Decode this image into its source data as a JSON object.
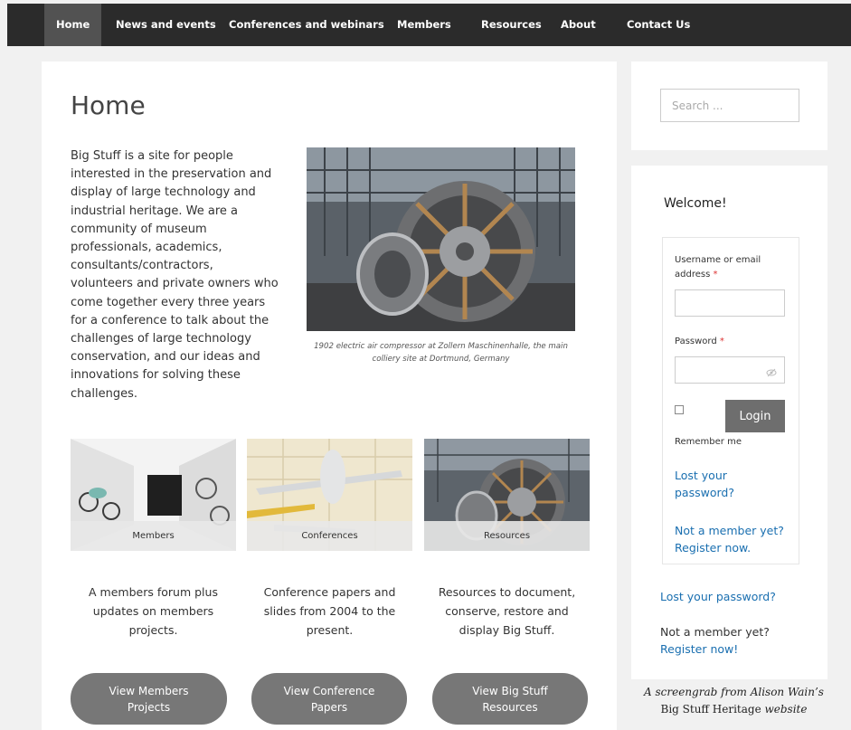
{
  "nav": {
    "items": [
      "Home",
      "News and events",
      "Conferences and webinars",
      "Members",
      "Resources",
      "About",
      "Contact Us"
    ],
    "active": "Home"
  },
  "main": {
    "title": "Home",
    "intro": "Big Stuff is a site for people interested in the preservation and display of large technology and industrial heritage. We are a community of museum professionals, academics, consultants/contractors, volunteers and private owners who come together every three years for a conference to talk about the challenges of large technology conservation, and our ideas and innovations for solving these challenges.",
    "hero_caption": "1902 electric air compressor at Zollern Maschinenhalle, the main colliery site at Dortmund, Germany",
    "tiles": [
      {
        "label": "Members",
        "description": "A members forum plus updates on members projects.",
        "button": "View Members Projects"
      },
      {
        "label": "Conferences",
        "description": "Conference papers and slides from 2004 to the present.",
        "button": "View Conference Papers"
      },
      {
        "label": "Resources",
        "description": "Resources to document, conserve, restore and display Big Stuff.",
        "button": "View Big Stuff Resources"
      }
    ]
  },
  "sidebar": {
    "search_placeholder": "Search ...",
    "welcome": "Welcome!",
    "login": {
      "username_label": "Username or email address",
      "password_label": "Password",
      "required_mark": "*",
      "button": "Login",
      "remember": "Remember me",
      "lost_password": "Lost your password?",
      "not_member": "Not a member yet?",
      "register": "Register now."
    },
    "lost_password": "Lost your password?",
    "not_member": "Not a member yet?",
    "register": "Register now!"
  },
  "caption": {
    "line1": "A screengrab from Alison Wain’s",
    "line2_site": "Big Stuff Heritage",
    "line2_suffix": "website"
  },
  "colors": {
    "nav_bg": "#2b2b2b",
    "nav_active": "#525252",
    "button_bg": "#777777",
    "link": "#1a6fb0",
    "required": "#dd3333"
  }
}
